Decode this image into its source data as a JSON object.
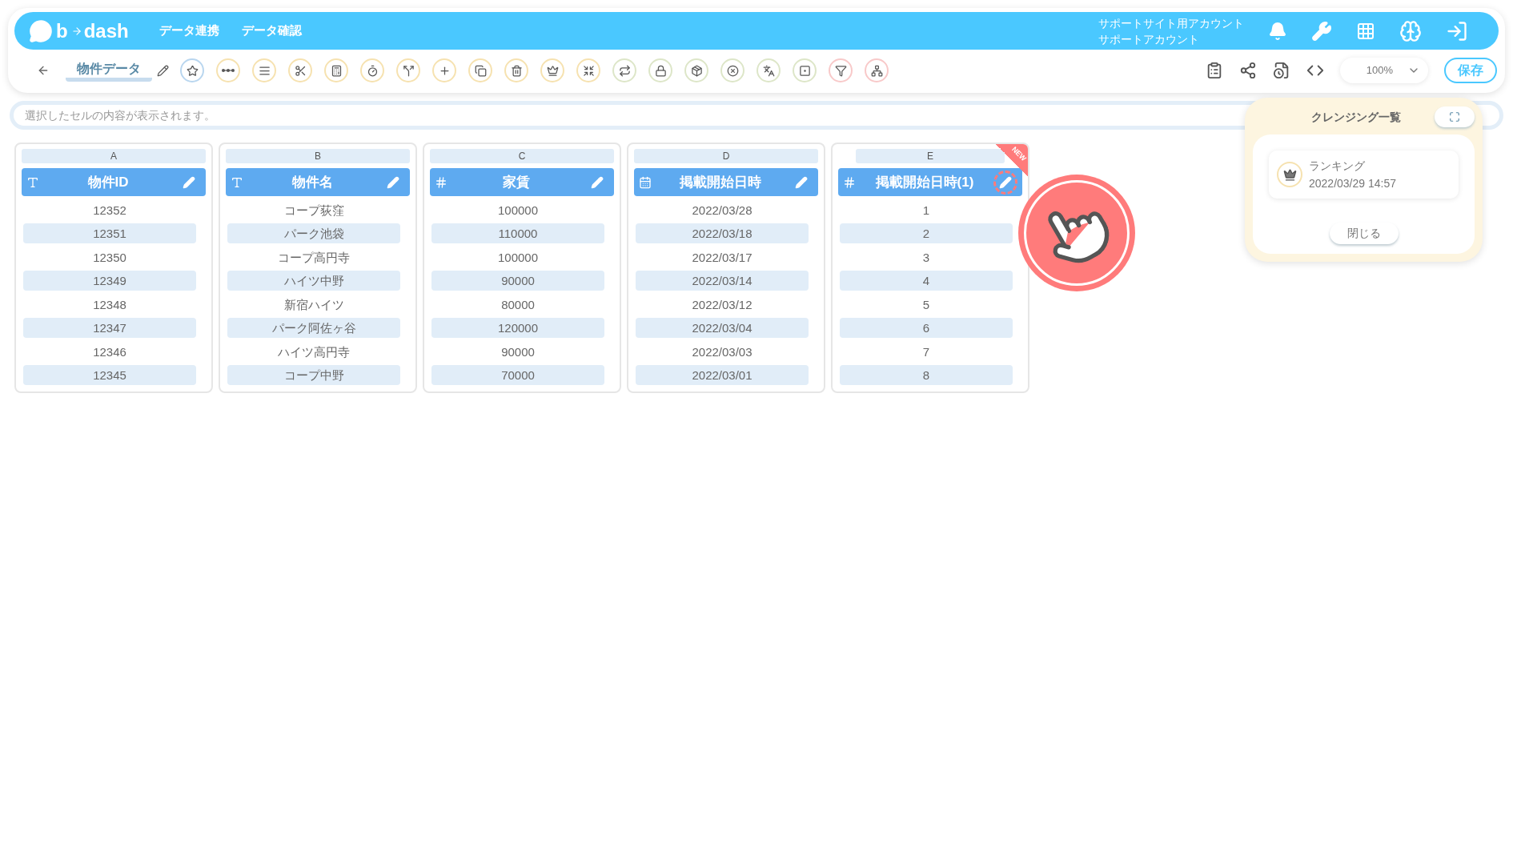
{
  "header": {
    "logo": {
      "left": "b",
      "right": "dash"
    },
    "nav": [
      {
        "label": "データ連携"
      },
      {
        "label": "データ確認"
      }
    ],
    "account": [
      "サポートサイト用アカウント",
      "サポートアカウント"
    ]
  },
  "toolbar": {
    "title": "物件データ",
    "zoom": "100%",
    "save": "保存"
  },
  "cell_field": {
    "placeholder": "選択したセルの内容が表示されます。"
  },
  "columns": [
    {
      "letter": "A",
      "name": "物件ID",
      "kind": "text",
      "is_new": false,
      "highlighted": false,
      "rows": [
        "12352",
        "12351",
        "12350",
        "12349",
        "12348",
        "12347",
        "12346",
        "12345"
      ]
    },
    {
      "letter": "B",
      "name": "物件名",
      "kind": "text",
      "is_new": false,
      "highlighted": false,
      "rows": [
        "コープ荻窪",
        "パーク池袋",
        "コープ高円寺",
        "ハイツ中野",
        "新宿ハイツ",
        "パーク阿佐ヶ谷",
        "ハイツ高円寺",
        "コープ中野"
      ]
    },
    {
      "letter": "C",
      "name": "家賃",
      "kind": "number",
      "is_new": false,
      "highlighted": false,
      "rows": [
        "100000",
        "110000",
        "100000",
        "90000",
        "80000",
        "120000",
        "90000",
        "70000"
      ]
    },
    {
      "letter": "D",
      "name": "掲載開始日時",
      "kind": "date",
      "is_new": false,
      "highlighted": false,
      "rows": [
        "2022/03/28",
        "2022/03/18",
        "2022/03/17",
        "2022/03/14",
        "2022/03/12",
        "2022/03/04",
        "2022/03/03",
        "2022/03/01"
      ]
    },
    {
      "letter": "E",
      "name": "掲載開始日時(1)",
      "kind": "number",
      "is_new": true,
      "highlighted": true,
      "rows": [
        "1",
        "2",
        "3",
        "4",
        "5",
        "6",
        "7",
        "8"
      ]
    }
  ],
  "new_badge": "NEW",
  "panel": {
    "title": "クレンジング一覧",
    "items": [
      {
        "name": "ランキング",
        "time": "2022/03/29 14:57"
      }
    ],
    "close": "閉じる"
  }
}
